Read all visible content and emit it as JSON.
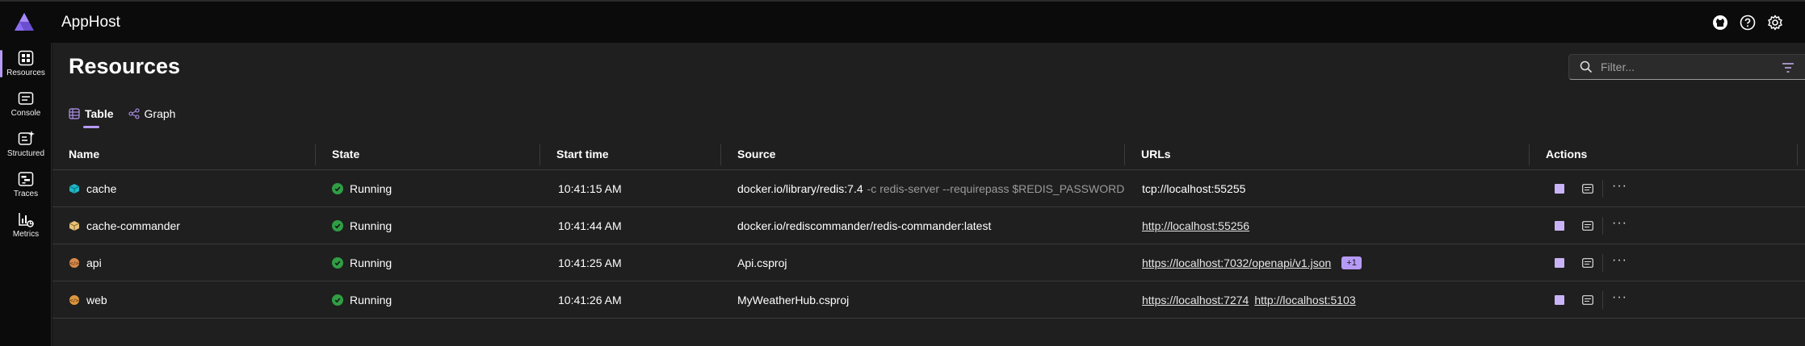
{
  "app": {
    "title": "AppHost",
    "accent": "#b69af6"
  },
  "header": {
    "icons": [
      "github-icon",
      "help-icon",
      "settings-icon"
    ]
  },
  "nav": {
    "items": [
      {
        "label": "Resources",
        "icon": "resources-icon",
        "active": true
      },
      {
        "label": "Console",
        "icon": "console-icon"
      },
      {
        "label": "Structured",
        "icon": "structured-logs-icon"
      },
      {
        "label": "Traces",
        "icon": "traces-icon"
      },
      {
        "label": "Metrics",
        "icon": "metrics-icon"
      }
    ]
  },
  "page": {
    "title": "Resources"
  },
  "filter": {
    "placeholder": "Filter..."
  },
  "tabs": [
    {
      "label": "Table",
      "active": true
    },
    {
      "label": "Graph"
    }
  ],
  "table": {
    "columns": [
      "Name",
      "State",
      "Start time",
      "Source",
      "URLs",
      "Actions"
    ],
    "rows": [
      {
        "name": "cache",
        "state": "Running",
        "start_time": "10:41:15 AM",
        "source": "docker.io/library/redis:7.4",
        "source_args": "-c redis-server --requirepass $REDIS_PASSWORD",
        "urls": [
          "tcp://localhost:55255"
        ]
      },
      {
        "name": "cache-commander",
        "state": "Running",
        "start_time": "10:41:44 AM",
        "source": "docker.io/rediscommander/redis-commander:latest",
        "source_args": "",
        "urls": [
          "http://localhost:55256"
        ]
      },
      {
        "name": "api",
        "state": "Running",
        "start_time": "10:41:25 AM",
        "source": "Api.csproj",
        "source_args": "",
        "urls": [
          "https://localhost:7032/openapi/v1.json"
        ],
        "extra_urls_badge": "+1"
      },
      {
        "name": "web",
        "state": "Running",
        "start_time": "10:41:26 AM",
        "source": "MyWeatherHub.csproj",
        "source_args": "",
        "urls": [
          "https://localhost:7274",
          "http://localhost:5103"
        ]
      }
    ]
  }
}
